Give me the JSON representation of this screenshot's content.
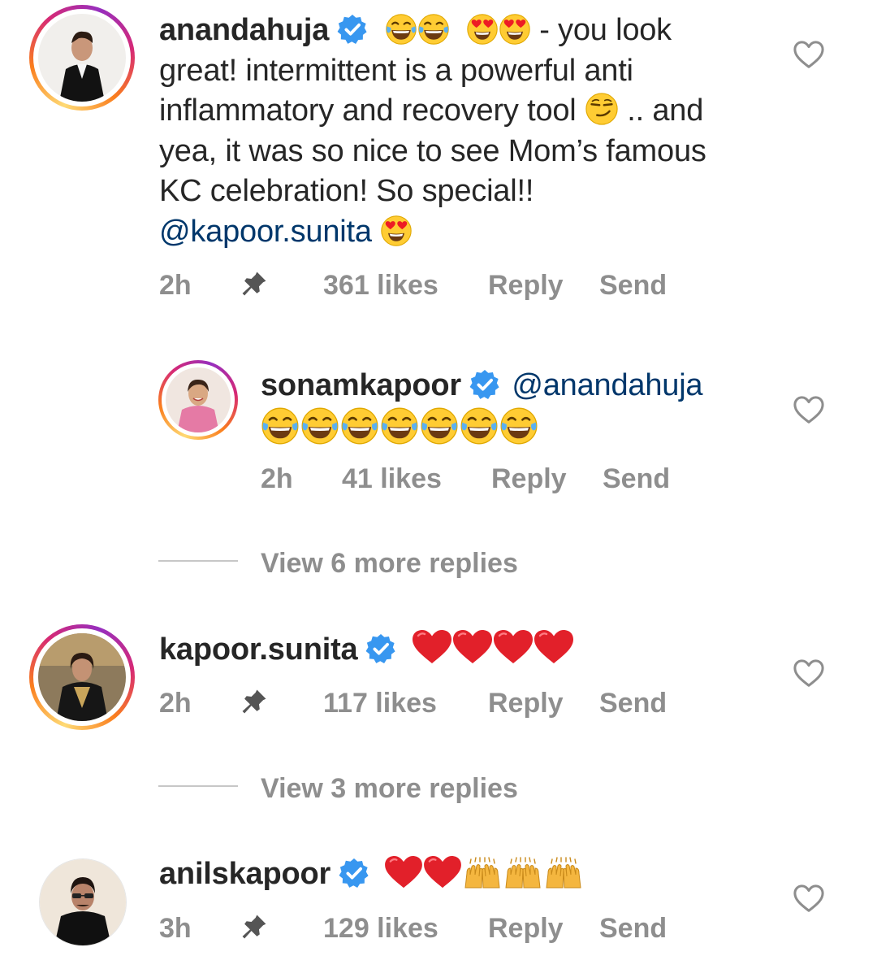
{
  "comments": [
    {
      "username": "anandahuja",
      "text_parts": [
        "- you look great! intermittent is a powerful anti inflammatory and recovery tool",
        "..",
        "and yea, it was so nice to see Mom’s famous KC celebration! So special!!"
      ],
      "mention": "@kapoor.sunita",
      "time": "2h",
      "likes": "361 likes",
      "reply": "Reply",
      "send": "Send"
    },
    {
      "username": "sonamkapoor",
      "mention": "@anandahuja",
      "time": "2h",
      "likes": "41 likes",
      "reply": "Reply",
      "send": "Send"
    },
    {
      "username": "kapoor.sunita",
      "time": "2h",
      "likes": "117 likes",
      "reply": "Reply",
      "send": "Send"
    },
    {
      "username": "anilskapoor",
      "time": "3h",
      "likes": "129 likes",
      "reply": "Reply",
      "send": "Send"
    }
  ],
  "view_more": [
    "View 6 more replies",
    "View 3 more replies"
  ],
  "icons": [
    "verified-badge-icon",
    "heart-icon",
    "pin-icon",
    "tears-of-joy-emoji",
    "heart-eyes-emoji",
    "smirk-emoji",
    "red-heart-emoji",
    "raising-hands-emoji"
  ],
  "colors": {
    "verified": "#3897f0",
    "mention": "#00376b",
    "meta": "#8e8e8e",
    "heart": "#ed1c24"
  }
}
